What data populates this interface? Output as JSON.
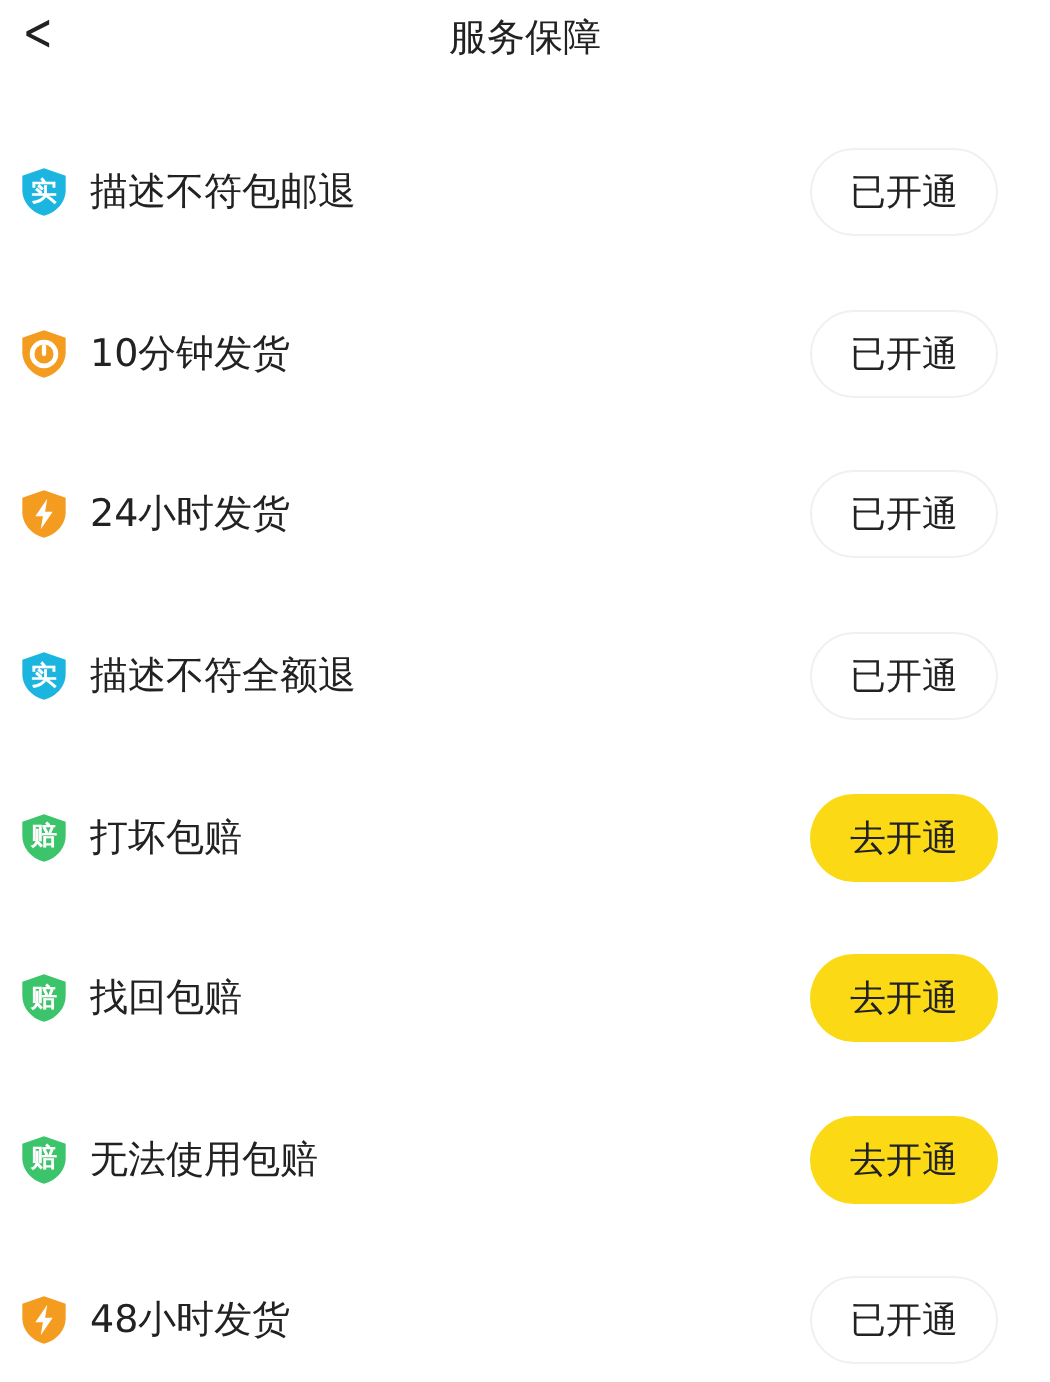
{
  "header": {
    "back": "<",
    "title": "服务保障"
  },
  "services": [
    {
      "icon": {
        "kind": "char",
        "char": "实",
        "color": "#1bb5e0"
      },
      "name": "描述不符包邮退",
      "activated": true,
      "action": "已开通"
    },
    {
      "icon": {
        "kind": "clock",
        "color": "#f39c1f"
      },
      "name": "10分钟发货",
      "activated": true,
      "action": "已开通"
    },
    {
      "icon": {
        "kind": "bolt",
        "color": "#f39c1f"
      },
      "name": "24小时发货",
      "activated": true,
      "action": "已开通"
    },
    {
      "icon": {
        "kind": "char",
        "char": "实",
        "color": "#1bb5e0"
      },
      "name": "描述不符全额退",
      "activated": true,
      "action": "已开通"
    },
    {
      "icon": {
        "kind": "char",
        "char": "赔",
        "color": "#3cc46a"
      },
      "name": "打坏包赔",
      "activated": false,
      "action": "去开通"
    },
    {
      "icon": {
        "kind": "char",
        "char": "赔",
        "color": "#3cc46a"
      },
      "name": "找回包赔",
      "activated": false,
      "action": "去开通"
    },
    {
      "icon": {
        "kind": "char",
        "char": "赔",
        "color": "#3cc46a"
      },
      "name": "无法使用包赔",
      "activated": false,
      "action": "去开通"
    },
    {
      "icon": {
        "kind": "bolt",
        "color": "#f39c1f"
      },
      "name": "48小时发货",
      "activated": true,
      "action": "已开通"
    }
  ]
}
